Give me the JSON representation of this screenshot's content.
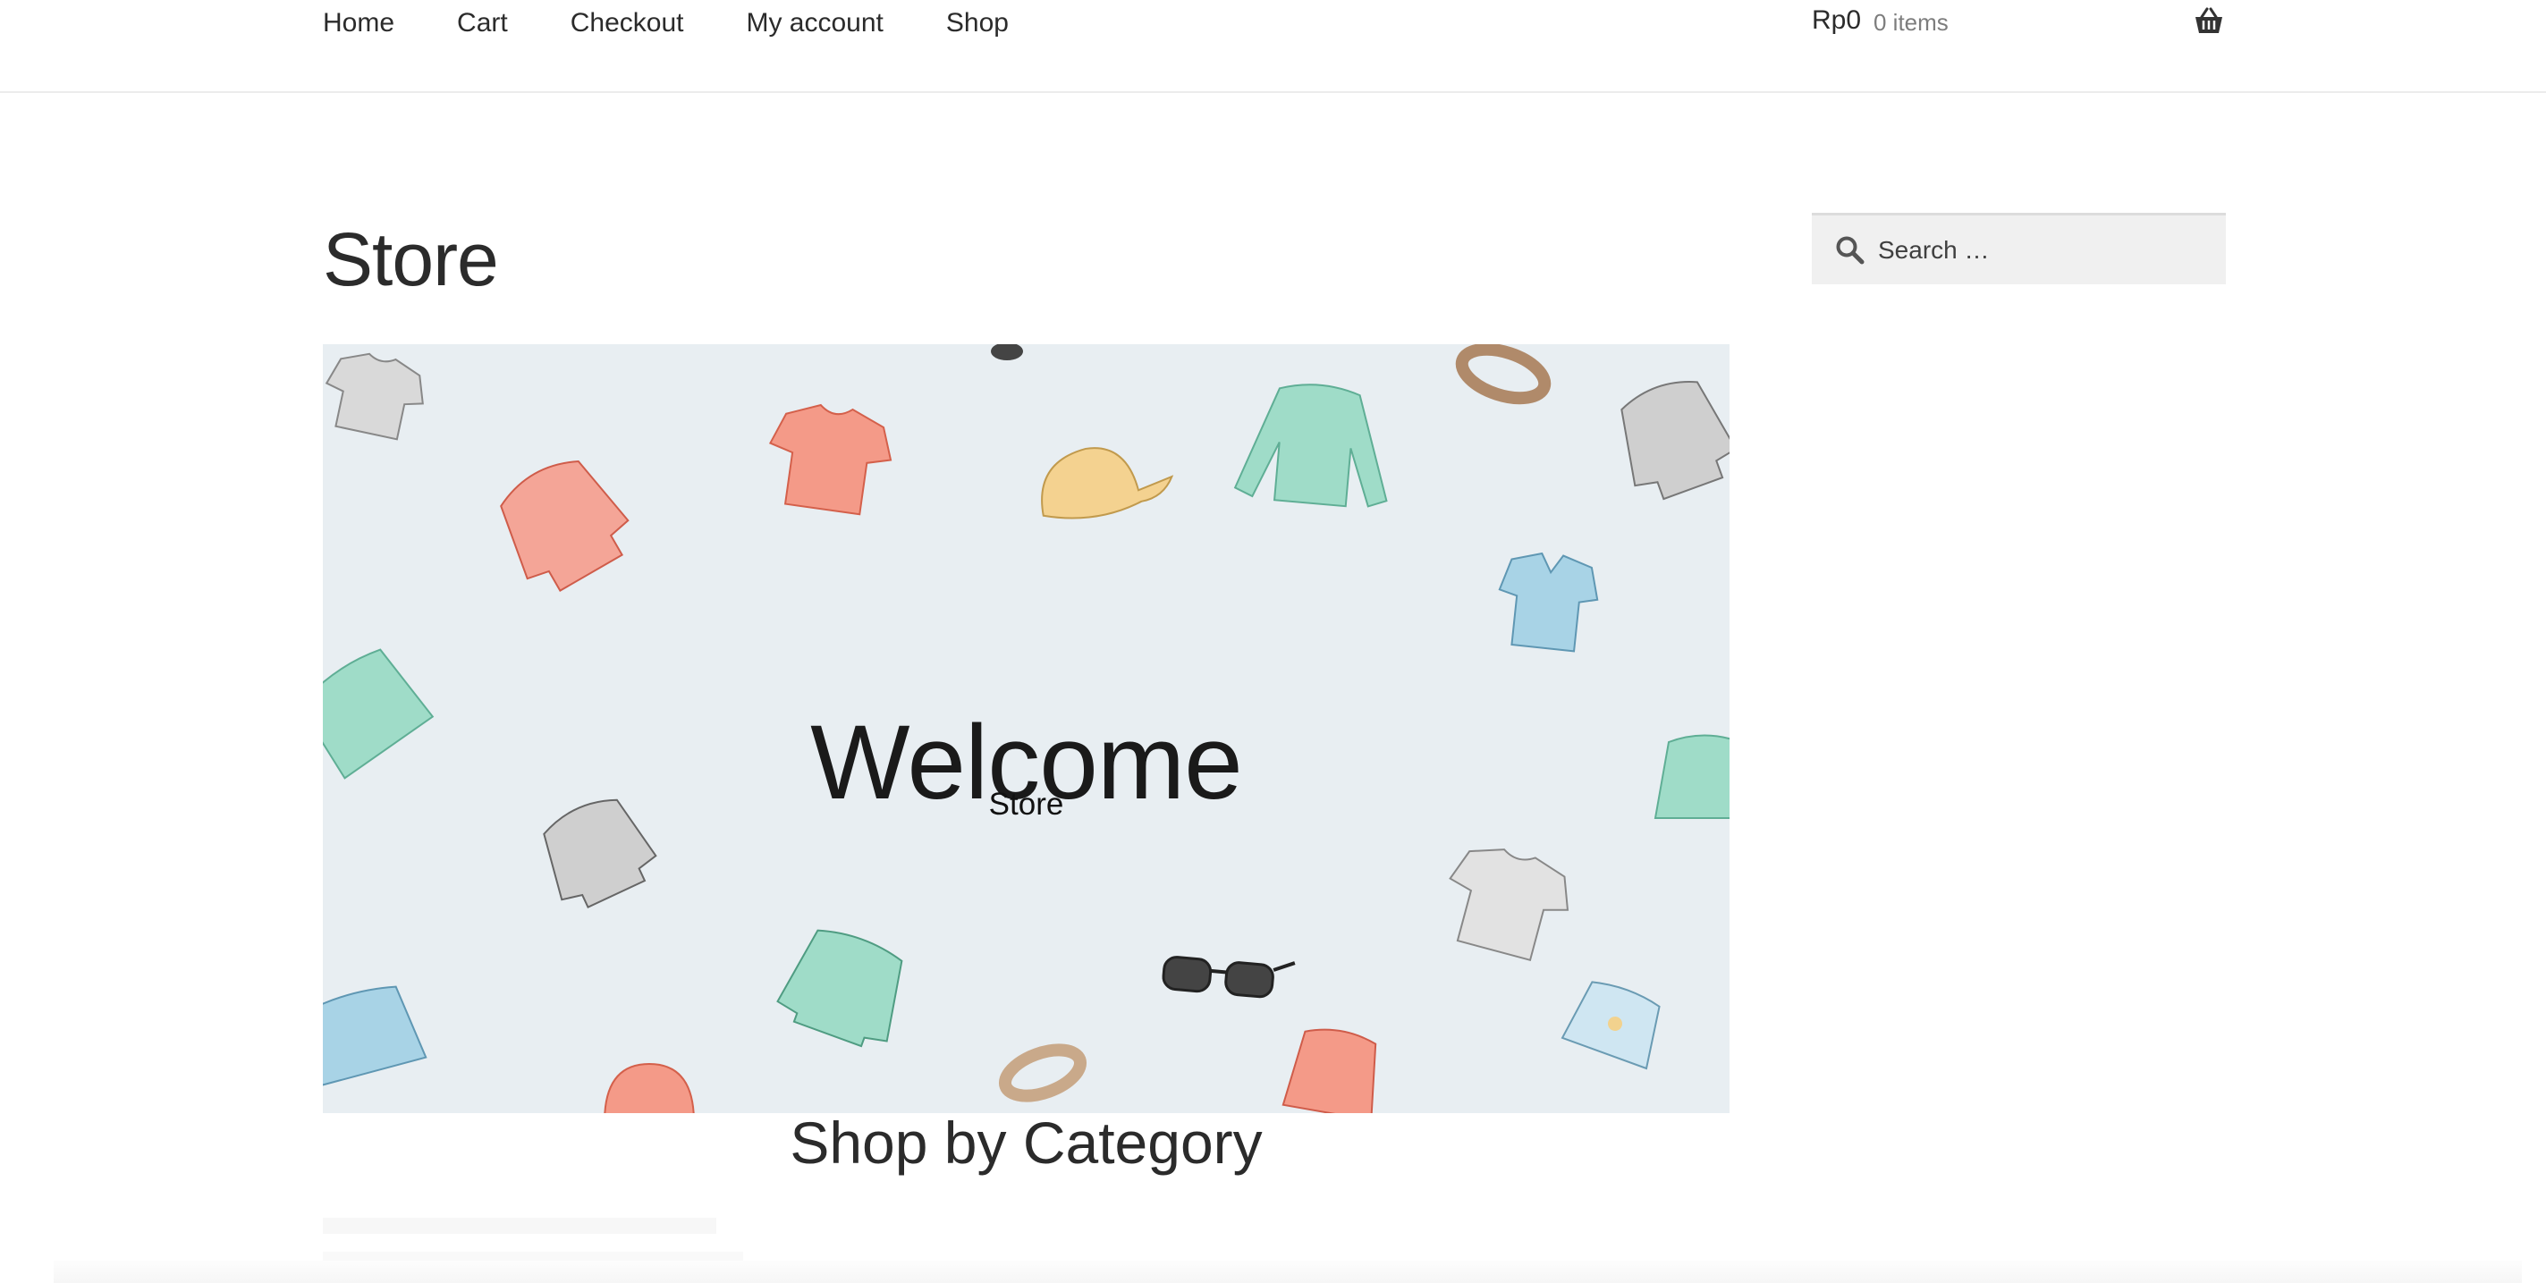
{
  "nav": {
    "items": [
      {
        "label": "Home"
      },
      {
        "label": "Cart"
      },
      {
        "label": "Checkout"
      },
      {
        "label": "My account"
      },
      {
        "label": "Shop"
      }
    ]
  },
  "cart": {
    "total": "Rp0",
    "count": "0 items",
    "icon": "basket-icon"
  },
  "page": {
    "title": "Store"
  },
  "hero": {
    "title": "Welcome",
    "subtitle": "Store"
  },
  "section": {
    "title": "Shop by Category"
  },
  "search": {
    "placeholder": "Search …",
    "value": "",
    "icon": "search-icon"
  },
  "colors": {
    "hero_bg": "#e8eef2",
    "mint": "#9fdcc8",
    "coral": "#f08e7e",
    "sky": "#a8d3e6",
    "sand": "#f2d28e",
    "grey": "#cfcfcf",
    "tan": "#c9a98a"
  }
}
